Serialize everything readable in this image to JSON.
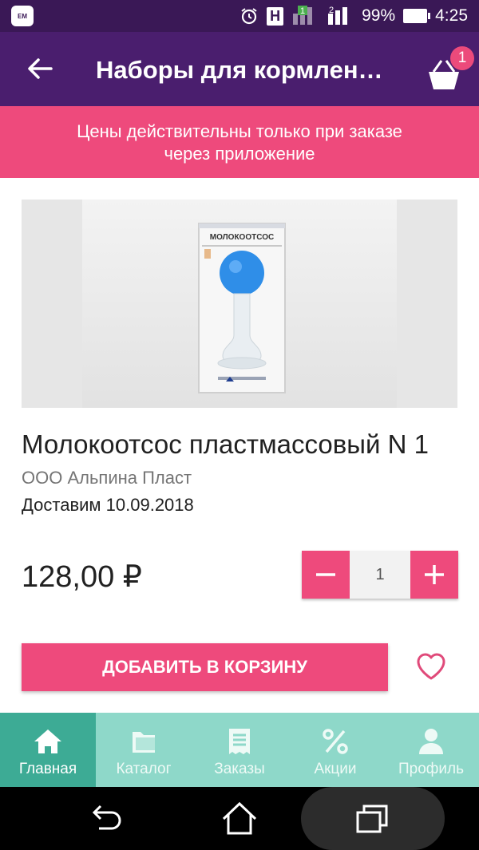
{
  "status_bar": {
    "app_badge": "EM",
    "network_badge": "H",
    "sim1": "1",
    "sim2": "2",
    "battery": "99%",
    "time": "4:25"
  },
  "app_bar": {
    "title": "Наборы для кормлен…",
    "cart_count": "1"
  },
  "promo": {
    "line1": "Цены действительны только при заказе",
    "line2": "через приложение"
  },
  "product": {
    "photo_label": "МОЛОКООТСОС",
    "name": "Молокоотсос пластмассовый N 1",
    "manufacturer": "ООО Альпина Пласт",
    "delivery": "Доставим 10.09.2018",
    "price": "128,00 ₽",
    "quantity": "1",
    "add_to_cart": "ДОБАВИТЬ В КОРЗИНУ"
  },
  "tabs": [
    {
      "label": "Главная",
      "icon": "home-icon",
      "active": true
    },
    {
      "label": "Каталог",
      "icon": "folder-icon",
      "active": false
    },
    {
      "label": "Заказы",
      "icon": "receipt-icon",
      "active": false
    },
    {
      "label": "Акции",
      "icon": "percent-icon",
      "active": false
    },
    {
      "label": "Профиль",
      "icon": "person-icon",
      "active": false
    }
  ],
  "colors": {
    "status_bar": "#3a1856",
    "app_bar": "#4a1e6e",
    "accent_pink": "#ee4a7c",
    "tab_bar": "#8ed8c9",
    "tab_active": "#3dab95"
  }
}
